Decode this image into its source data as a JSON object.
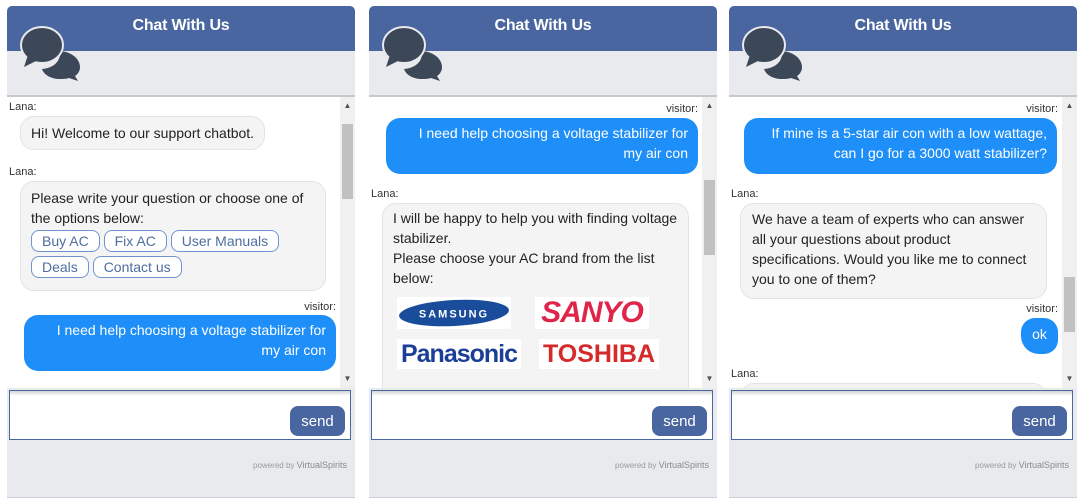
{
  "widget": {
    "title": "Chat With Us",
    "send_label": "send",
    "input_placeholder": "",
    "input_value": "",
    "powered_prefix": "powered by",
    "powered_brand": "VirtualSpirits",
    "colors": {
      "header": "#4a66a0",
      "user_bubble": "#1e8ef8",
      "bot_bubble": "#f4f4f4",
      "panel_bg": "#e9eaee",
      "option_border": "#6f94d0"
    }
  },
  "panels": [
    {
      "messages": [
        {
          "sender": "Lana:",
          "role": "bot",
          "text": "Hi! Welcome to our support chatbot."
        },
        {
          "sender": "Lana:",
          "role": "bot",
          "text": "Please write your question or choose one of the options below:",
          "options": [
            "Buy AC",
            "Fix AC",
            "User Manuals",
            "Deals",
            "Contact us"
          ]
        },
        {
          "sender": "visitor:",
          "role": "user",
          "text_lines": [
            "I need help choosing a voltage stabilizer for",
            "my air con"
          ]
        }
      ]
    },
    {
      "messages": [
        {
          "sender": "visitor:",
          "role": "user",
          "text_lines": [
            "I need help choosing a voltage stabilizer for",
            "my air con"
          ]
        },
        {
          "sender": "Lana:",
          "role": "bot",
          "text_lines": [
            "I will be happy to help you with finding voltage",
            "stabilizer.",
            "Please choose your AC brand from the list",
            "below:"
          ],
          "brands": [
            "SAMSUNG",
            "SANYO",
            "Panasonic",
            "TOSHIBA"
          ]
        }
      ]
    },
    {
      "messages": [
        {
          "sender": "visitor:",
          "role": "user",
          "text_lines": [
            "If mine is a 5-star air con with a low wattage,",
            "can I go for a 3000 watt stabilizer?"
          ]
        },
        {
          "sender": "Lana:",
          "role": "bot",
          "text_lines": [
            "We have a team of experts who can answer",
            "all your questions about product",
            "specifications. Would you like me to connect",
            "you to one of them?"
          ]
        },
        {
          "sender": "visitor:",
          "role": "user",
          "text": "ok"
        },
        {
          "sender": "Lana:",
          "role": "bot",
          "text": ""
        }
      ]
    }
  ]
}
